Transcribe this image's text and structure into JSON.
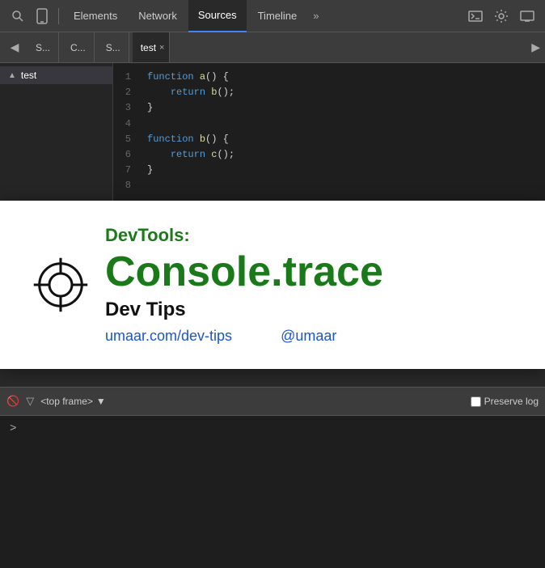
{
  "toolbar": {
    "search_icon": "🔍",
    "device_icon": "📱",
    "tabs": [
      {
        "label": "Elements",
        "active": false
      },
      {
        "label": "Network",
        "active": false
      },
      {
        "label": "Sources",
        "active": true
      },
      {
        "label": "Timeline",
        "active": false
      }
    ],
    "more_label": "»",
    "terminal_icon": "⌨",
    "gear_icon": "⚙",
    "screen_icon": "🖥"
  },
  "subtoolbar": {
    "tabs": [
      {
        "label": "S...",
        "active": false
      },
      {
        "label": "C...",
        "active": false
      },
      {
        "label": "S...",
        "active": false
      }
    ],
    "back_icon": "◀",
    "active_file": "test",
    "close_icon": "×",
    "right_icon": "▶"
  },
  "file_tree": {
    "items": [
      {
        "label": "test",
        "active": true,
        "icon": "▲"
      }
    ]
  },
  "code": {
    "lines": [
      {
        "num": "1",
        "content": "function a() {"
      },
      {
        "num": "2",
        "content": "    return b();"
      },
      {
        "num": "3",
        "content": "}"
      },
      {
        "num": "4",
        "content": ""
      },
      {
        "num": "5",
        "content": "function b() {"
      },
      {
        "num": "6",
        "content": "    return c();"
      },
      {
        "num": "7",
        "content": "}"
      },
      {
        "num": "8",
        "content": ""
      }
    ]
  },
  "overlay": {
    "label": "DevTools:",
    "title": "Console.trace",
    "subtitle": "Dev Tips",
    "link1": "umaar.com/dev-tips",
    "link2": "@umaar"
  },
  "console": {
    "icons": [
      "🚫",
      "▽"
    ],
    "frame_label": "<top frame>",
    "dropdown_arrow": "▼",
    "preserve_label": "Preserve log",
    "prompt": ">"
  }
}
